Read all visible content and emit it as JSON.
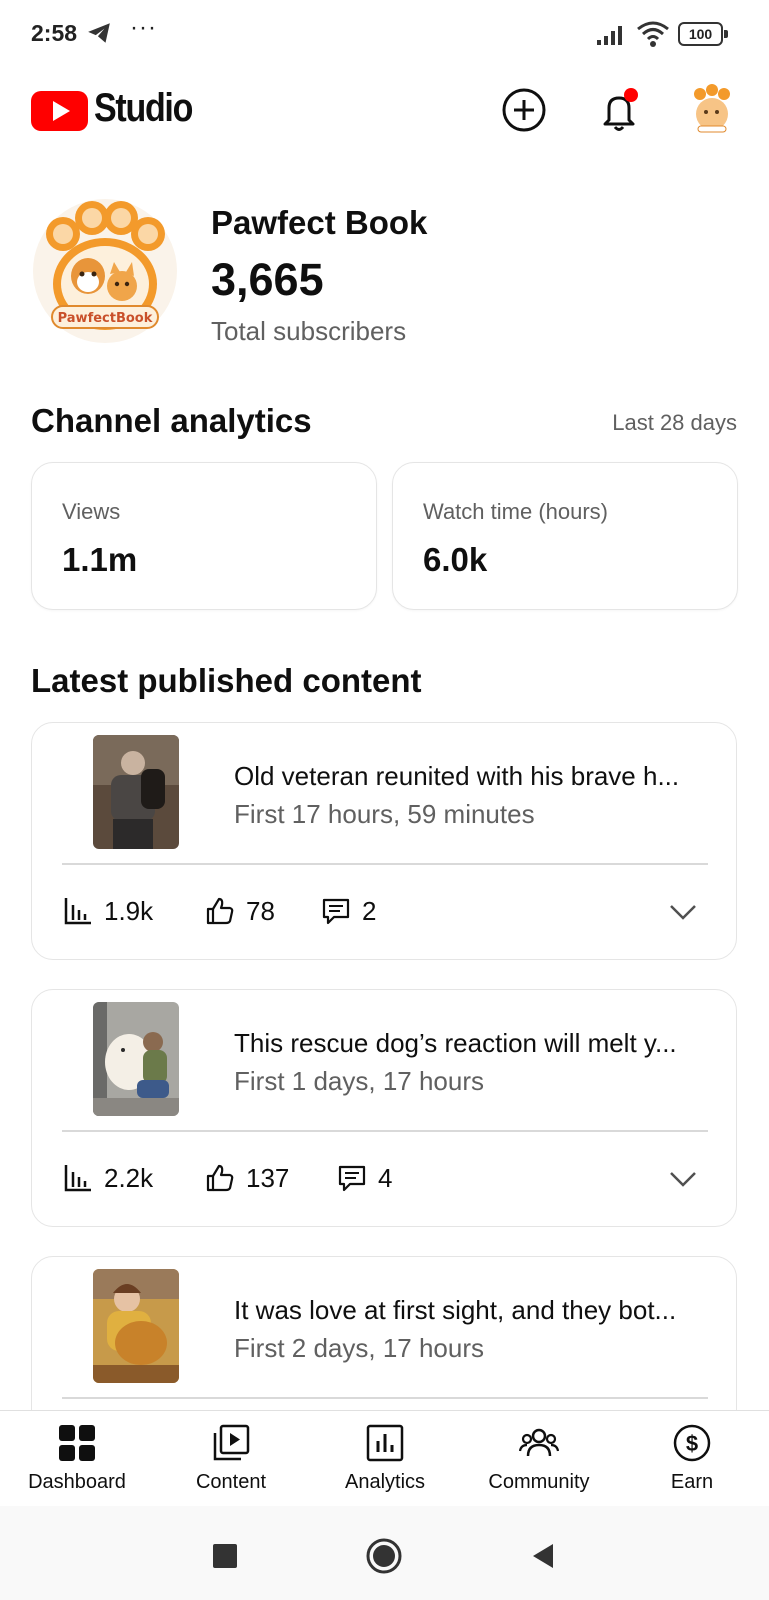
{
  "status_bar": {
    "time": "2:58",
    "more": "···",
    "battery": "100"
  },
  "header": {
    "brand": "Studio"
  },
  "channel": {
    "name": "Pawfect Book",
    "subscribers": "3,665",
    "subscribers_label": "Total subscribers",
    "logo_text": "PawfectBook"
  },
  "analytics": {
    "title": "Channel analytics",
    "period": "Last 28 days",
    "metrics": [
      {
        "label": "Views",
        "value": "1.1m"
      },
      {
        "label": "Watch time (hours)",
        "value": "6.0k"
      }
    ]
  },
  "latest": {
    "title": "Latest published content",
    "videos": [
      {
        "title": "Old veteran reunited with his brave h...",
        "age": "First 17 hours, 59 minutes",
        "views": "1.9k",
        "likes": "78",
        "comments": "2"
      },
      {
        "title": "This rescue dog’s reaction will melt y...",
        "age": "First 1 days, 17 hours",
        "views": "2.2k",
        "likes": "137",
        "comments": "4"
      },
      {
        "title": "It was love at first sight, and they bot...",
        "age": "First 2 days, 17 hours"
      }
    ]
  },
  "bottom_nav": [
    {
      "label": "Dashboard",
      "icon": "dashboard-icon"
    },
    {
      "label": "Content",
      "icon": "content-icon"
    },
    {
      "label": "Analytics",
      "icon": "analytics-icon"
    },
    {
      "label": "Community",
      "icon": "community-icon"
    },
    {
      "label": "Earn",
      "icon": "earn-icon"
    }
  ],
  "colors": {
    "brand_red": "#ff0000",
    "text": "#0f0f0f",
    "secondary_text": "#606060",
    "paw_orange": "#f39a2b"
  }
}
